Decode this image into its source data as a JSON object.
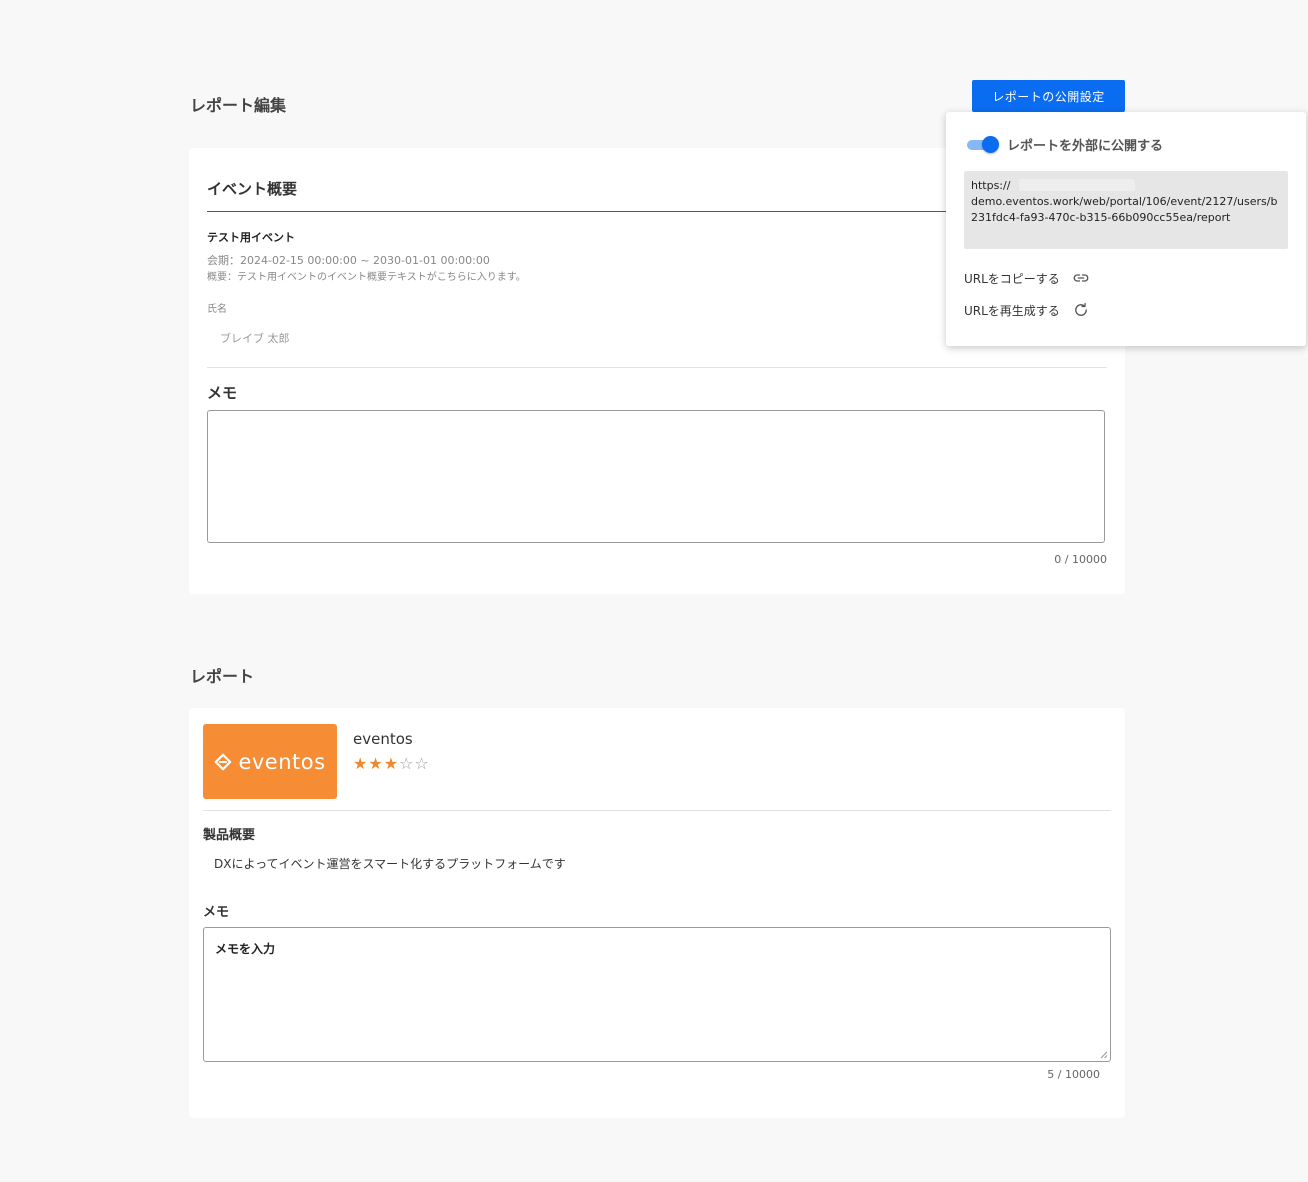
{
  "page": {
    "title": "レポート編集",
    "publish_button": "レポートの公開設定"
  },
  "event_card": {
    "heading": "イベント概要",
    "event_name": "テスト用イベント",
    "period": "会期：2024-02-15 00:00:00 ~ 2030-01-01 00:00:00",
    "summary": "概要：テスト用イベントのイベント概要テキストがこちらに入ります。",
    "name_label": "氏名",
    "name_value": "ブレイブ 太郎",
    "memo_label": "メモ",
    "memo_value": "",
    "memo_counter": "0 / 10000"
  },
  "report_section": {
    "title": "レポート"
  },
  "report_card": {
    "logo_text": "eventos",
    "logo_color": "#f68c33",
    "product_name": "eventos",
    "rating": 3,
    "rating_max": 5,
    "star_filled": "★★★",
    "star_empty": "☆☆",
    "overview_label": "製品概要",
    "overview_text": "DXによってイベント運営をスマート化するプラットフォームです",
    "memo_label": "メモ",
    "memo_value": "メモを入力",
    "memo_counter": "5 / 10000"
  },
  "publish_popover": {
    "toggle_label": "レポートを外部に公開する",
    "toggle_on": true,
    "url": "https://demo.eventos.work/web/portal/106/event/2127/users/b231fdc4-fa93-470c-b315-66b090cc55ea/report",
    "url_line1": "https://",
    "url_line2": "demo.eventos.work/web/portal/106/event/2127/users/b231fdc4-fa93-470c-b315-66b090cc55ea/report",
    "copy_label": "URLをコピーする",
    "copy_icon": "link-icon",
    "regen_label": "URLを再生成する",
    "regen_icon": "refresh-icon"
  },
  "colors": {
    "primary": "#0a6cf0",
    "background": "#f8f8f8",
    "star": "#f0882e",
    "heading_rule": "#1e64b4"
  }
}
